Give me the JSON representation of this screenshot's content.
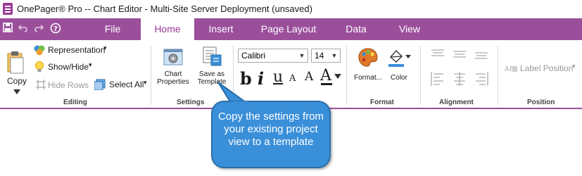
{
  "window": {
    "title": "OnePager® Pro --  Chart Editor - Multi-Site Server Deployment (unsaved)"
  },
  "quick_access": {
    "save_icon": "save-icon",
    "undo_icon": "undo-icon",
    "redo_icon": "redo-icon",
    "help_icon": "help-icon"
  },
  "tabs": [
    {
      "label": "File"
    },
    {
      "label": "Home"
    },
    {
      "label": "Insert"
    },
    {
      "label": "Page Layout"
    },
    {
      "label": "Data"
    },
    {
      "label": "View"
    }
  ],
  "editing": {
    "copy_label": "Copy",
    "representation_label": "Representation",
    "showhide_label": "Show/Hide",
    "hide_rows_label": "Hide Rows",
    "select_all_label": "Select All",
    "group_label": "Editing"
  },
  "settings": {
    "chart_properties_line1": "Chart",
    "chart_properties_line2": "Properties",
    "save_template_line1": "Save as",
    "save_template_line2": "Template",
    "group_label": "Settings"
  },
  "font": {
    "family": "Calibri",
    "size": "14",
    "bold_glyph": "b",
    "italic_glyph": "i",
    "underline_glyph": "u",
    "grow_glyph": "A",
    "shrink_glyph": "A",
    "color_glyph": "A"
  },
  "format": {
    "format_label": "Format...",
    "color_label": "Color",
    "group_label": "Format"
  },
  "alignment": {
    "group_label": "Alignment"
  },
  "position": {
    "label_position_label": "Label Position",
    "group_label": "Position"
  },
  "callout": {
    "text": "Copy the settings from your existing project view to a template"
  },
  "colors": {
    "accent": "#9b4f9b",
    "callout": "#3a8fd9"
  }
}
